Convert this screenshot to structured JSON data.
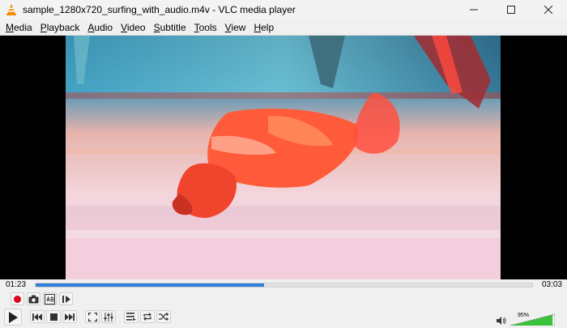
{
  "window": {
    "title": "sample_1280x720_surfing_with_audio.m4v - VLC media player",
    "controls": [
      "minimize",
      "maximize",
      "close"
    ]
  },
  "menu": [
    {
      "label": "Media",
      "accel": "M",
      "rest": "edia"
    },
    {
      "label": "Playback",
      "accel": "P",
      "rest": "layback"
    },
    {
      "label": "Audio",
      "accel": "A",
      "rest": "udio"
    },
    {
      "label": "Video",
      "accel": "V",
      "rest": "ideo"
    },
    {
      "label": "Subtitle",
      "accel": "S",
      "rest": "ubtitle"
    },
    {
      "label": "Tools",
      "accel": "T",
      "rest": "ools"
    },
    {
      "label": "View",
      "accel": "V",
      "rest": "iew"
    },
    {
      "label": "Help",
      "accel": "H",
      "rest": "elp"
    }
  ],
  "playback": {
    "elapsed": "01:23",
    "duration": "03:03",
    "progress": 0.46
  },
  "volume": {
    "label": "95%",
    "level": 0.95
  },
  "colors": {
    "accent": "#2f7fd8",
    "record": "#e0001b",
    "volume_green": "#3cc13c"
  },
  "icons": {
    "record": "record-icon",
    "snapshot": "camera-icon",
    "loop_ab": "ab-loop-icon",
    "frame_step": "frame-step-icon",
    "play": "play-icon",
    "previous": "skip-back-icon",
    "stop": "stop-icon",
    "next": "skip-forward-icon",
    "fullscreen": "fullscreen-icon",
    "extended": "equalizer-icon",
    "playlist": "playlist-icon",
    "loop": "loop-icon",
    "shuffle": "shuffle-icon",
    "speaker": "speaker-icon"
  }
}
